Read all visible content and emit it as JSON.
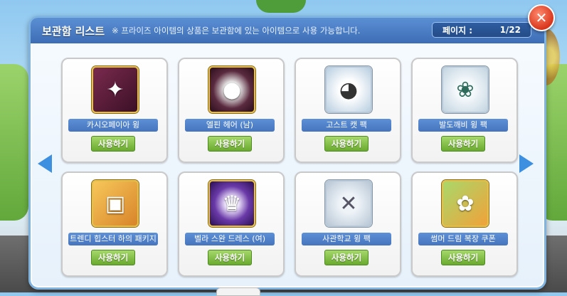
{
  "header": {
    "title": "보관함 리스트",
    "notice": "※ 프라이즈 아이템의 상품은 보관함에 있는 아이템으로 사용 가능합니다.",
    "page_label": "페이지 :",
    "page_value": "1/22"
  },
  "close_label": "✕",
  "nav": {
    "prev_icon": "chevron-left-icon",
    "next_icon": "chevron-right-icon"
  },
  "items": [
    {
      "name": "카시오페이아 윙",
      "action": "사용하기",
      "icon": "wing-icon",
      "bg": "#5a1e3a"
    },
    {
      "name": "엘핀 헤어 (남)",
      "action": "사용하기",
      "icon": "hair-icon",
      "bg": "#3b1a2c"
    },
    {
      "name": "고스트 캣 팩",
      "action": "사용하기",
      "icon": "cat-icon",
      "bg": "#cfe0ee"
    },
    {
      "name": "발도깨비 윙 팩",
      "action": "사용하기",
      "icon": "wing-pack-icon",
      "bg": "#d8e6ee"
    },
    {
      "name": "트렌디 힙스터 하의 패키지",
      "action": "사용하기",
      "icon": "package-icon",
      "bg": "#e9a33a"
    },
    {
      "name": "벨라 스완 드레스 (여)",
      "action": "사용하기",
      "icon": "dress-icon",
      "bg": "#3a1a6a"
    },
    {
      "name": "사관학교 윙 팩",
      "action": "사용하기",
      "icon": "emblem-icon",
      "bg": "#cbd7e2"
    },
    {
      "name": "썸머 드림 복장 쿠폰",
      "action": "사용하기",
      "icon": "coupon-icon",
      "bg": "#7ab43c"
    }
  ]
}
